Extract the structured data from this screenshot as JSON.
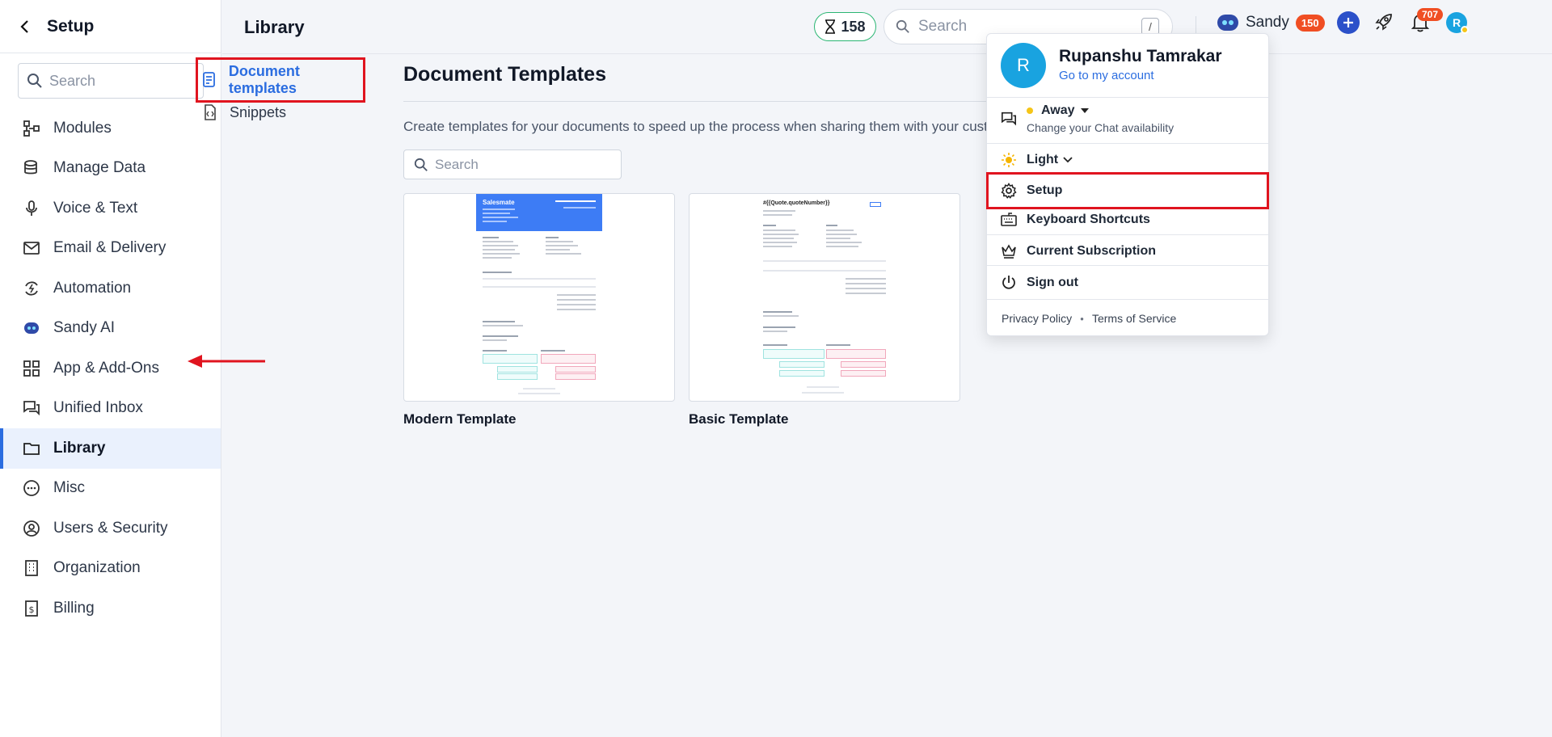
{
  "sidebar": {
    "title": "Setup",
    "search_placeholder": "Search",
    "items": [
      {
        "label": "Modules",
        "icon": "modules-icon"
      },
      {
        "label": "Manage Data",
        "icon": "database-icon"
      },
      {
        "label": "Voice & Text",
        "icon": "microphone-icon"
      },
      {
        "label": "Email & Delivery",
        "icon": "mail-icon"
      },
      {
        "label": "Automation",
        "icon": "automation-icon"
      },
      {
        "label": "Sandy AI",
        "icon": "robot-icon"
      },
      {
        "label": "App & Add-Ons",
        "icon": "apps-grid-icon"
      },
      {
        "label": "Unified Inbox",
        "icon": "chat-icon"
      },
      {
        "label": "Library",
        "icon": "folder-icon",
        "active": true
      },
      {
        "label": "Misc",
        "icon": "more-circle-icon"
      },
      {
        "label": "Users & Security",
        "icon": "user-circle-icon"
      },
      {
        "label": "Organization",
        "icon": "building-icon"
      },
      {
        "label": "Billing",
        "icon": "billing-icon"
      }
    ]
  },
  "topbar": {
    "page_title": "Library",
    "timer_value": "158",
    "search_placeholder": "Search",
    "search_shortcut": "/",
    "assistant_name": "Sandy",
    "assistant_badge": "150",
    "notifications_count": "707",
    "avatar_initial": "R"
  },
  "subnav": {
    "items": [
      {
        "label": "Document templates",
        "active": true
      },
      {
        "label": "Snippets",
        "active": false
      }
    ]
  },
  "main": {
    "title": "Document Templates",
    "description": "Create templates for your documents to speed up the process when sharing them with your customers. I",
    "search_placeholder": "Search",
    "templates": [
      {
        "name": "Modern Template",
        "logo": "Salesmate"
      },
      {
        "name": "Basic Template",
        "header": "#{{Quote.quoteNumber}}"
      }
    ]
  },
  "dropdown": {
    "avatar_initial": "R",
    "user_name": "Rupanshu Tamrakar",
    "account_link": "Go to my account",
    "status": "Away",
    "status_hint": "Change your Chat availability",
    "theme": "Light",
    "menu": [
      {
        "label": "Setup",
        "icon": "gear-icon",
        "highlighted": true
      },
      {
        "label": "Keyboard Shortcuts",
        "icon": "keyboard-icon"
      },
      {
        "label": "Current Subscription",
        "icon": "crown-icon"
      },
      {
        "label": "Sign out",
        "icon": "power-icon"
      }
    ],
    "footer": {
      "privacy": "Privacy Policy",
      "terms": "Terms of Service"
    }
  },
  "colors": {
    "accent": "#2b6de0",
    "highlight_box": "#e0141f",
    "badge": "#f04e23",
    "avatar": "#19a3e0",
    "away": "#f5c518"
  }
}
